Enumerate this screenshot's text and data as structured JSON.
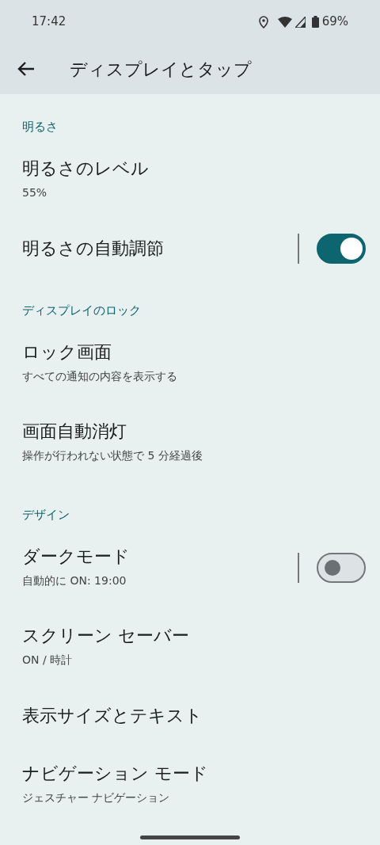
{
  "status_bar": {
    "time": "17:42",
    "battery": "69%"
  },
  "app_bar": {
    "title": "ディスプレイとタップ"
  },
  "sections": [
    {
      "header": "明るさ",
      "items": [
        {
          "kind": "plain",
          "title": "明るさのレベル",
          "subtitle": "55%"
        },
        {
          "kind": "switch",
          "title": "明るさの自動調節",
          "on": true
        }
      ]
    },
    {
      "header": "ディスプレイのロック",
      "items": [
        {
          "kind": "plain",
          "title": "ロック画面",
          "subtitle": "すべての通知の内容を表示する"
        },
        {
          "kind": "plain",
          "title": "画面自動消灯",
          "subtitle": "操作が行われない状態で 5 分経過後"
        }
      ]
    },
    {
      "header": "デザイン",
      "items": [
        {
          "kind": "switch",
          "title": "ダークモード",
          "subtitle": "自動的に ON: 19:00",
          "on": false
        },
        {
          "kind": "plain",
          "title": "スクリーン セーバー",
          "subtitle": "ON / 時計"
        },
        {
          "kind": "plain",
          "title": "表示サイズとテキスト"
        },
        {
          "kind": "plain",
          "title": "ナビゲーション モード",
          "subtitle": "ジェスチャー ナビゲーション"
        }
      ]
    }
  ]
}
